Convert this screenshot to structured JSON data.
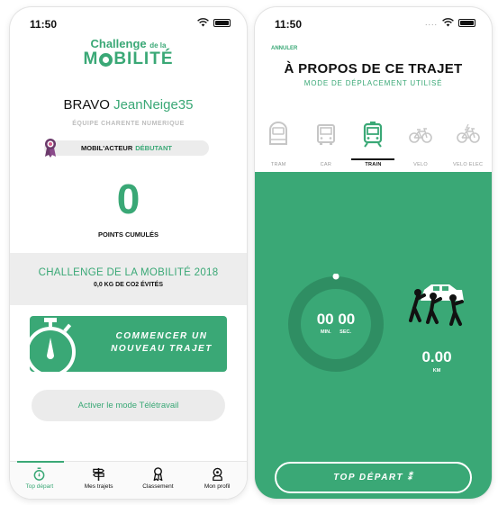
{
  "left": {
    "status": {
      "time": "11:50"
    },
    "logo": {
      "line1": "Challenge",
      "line1_small": "de la",
      "line2_before": "M",
      "line2_after": "BILITÉ"
    },
    "greeting": {
      "prefix": "BRAVO",
      "username": "JeanNeige35"
    },
    "team": "ÉQUIPE CHARENTE NUMERIQUE",
    "level": {
      "label": "MOBIL'ACTEUR",
      "value": "DÉBUTANT"
    },
    "points": {
      "value": "0",
      "label": "POINTS CUMULÉS"
    },
    "challenge": {
      "title": "CHALLENGE DE LA MOBILITÉ 2018",
      "co2": "0,0 KG DE CO2 ÉVITÉS"
    },
    "start_button": {
      "line1": "COMMENCER UN",
      "line2": "NOUVEAU TRAJET"
    },
    "telework_button": "Activer le mode Télétravail",
    "tabs": [
      {
        "label": "Top départ",
        "icon": "stopwatch-icon"
      },
      {
        "label": "Mes trajets",
        "icon": "signpost-icon"
      },
      {
        "label": "Classement",
        "icon": "ribbon-icon"
      },
      {
        "label": "Mon profil",
        "icon": "profile-icon"
      }
    ]
  },
  "right": {
    "status": {
      "time": "11:50"
    },
    "cancel": "ANNULER",
    "title": "À PROPOS DE CE TRAJET",
    "subtitle": "MODE DE DÉPLACEMENT UTILISÉ",
    "modes": [
      {
        "label": "TRAM",
        "icon": "tram-icon"
      },
      {
        "label": "CAR",
        "icon": "bus-icon"
      },
      {
        "label": "TRAIN",
        "icon": "train-icon",
        "active": true
      },
      {
        "label": "VELO",
        "icon": "bicycle-icon"
      },
      {
        "label": "VELO ELEC",
        "icon": "electric-bicycle-icon"
      }
    ],
    "timer": {
      "value": "00 00",
      "unit_min": "MIN.",
      "unit_sec": "SEC."
    },
    "distance": {
      "value": "0.00",
      "unit": "KM"
    },
    "depart_button": "TOP DÉPART"
  },
  "colors": {
    "brand_green": "#3aa876",
    "panel_gray": "#ededed"
  }
}
